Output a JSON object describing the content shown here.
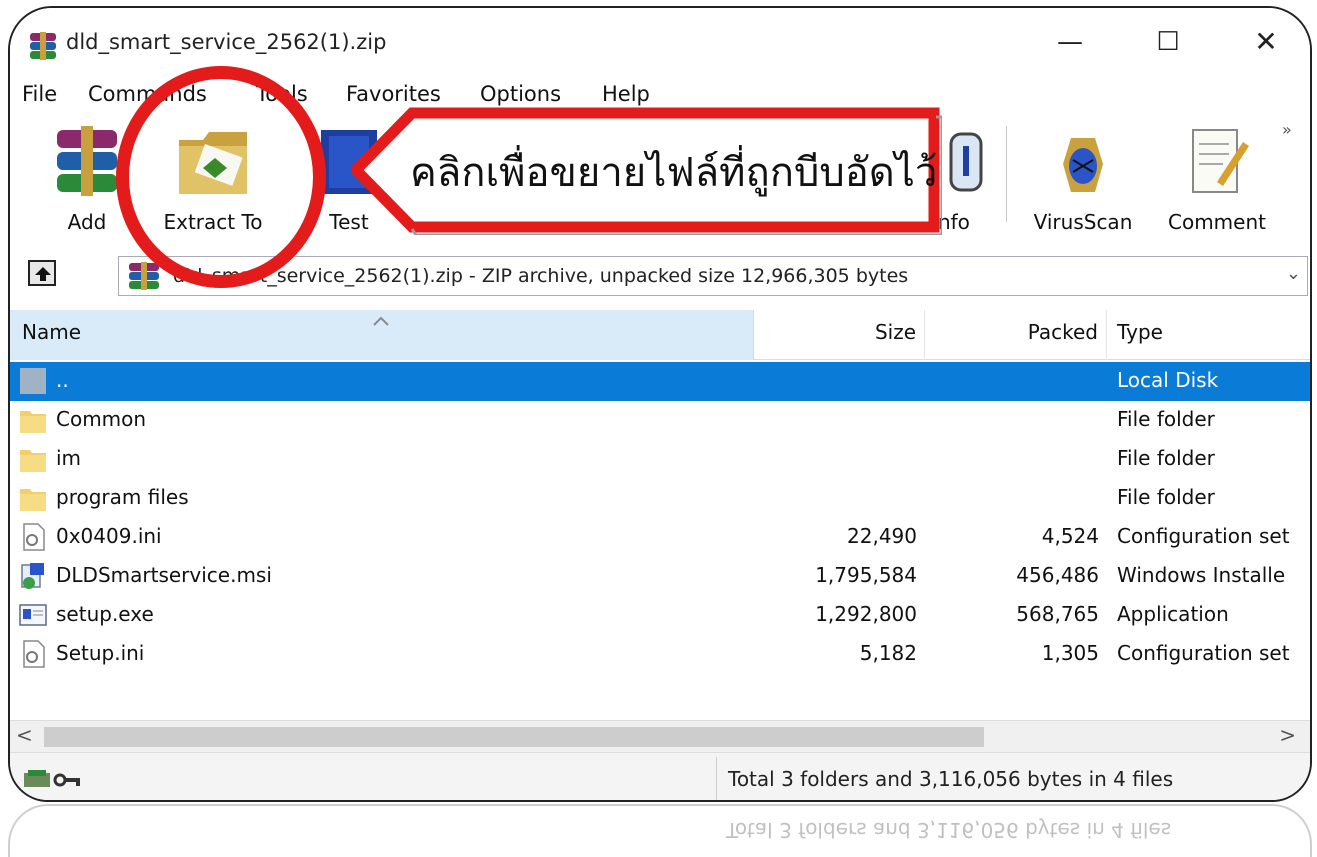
{
  "window": {
    "title": "dld_smart_service_2562(1).zip",
    "minimize": "—",
    "maximize": "☐",
    "close": "✕"
  },
  "menu": [
    "File",
    "Commands",
    "Tools",
    "Favorites",
    "Options",
    "Help"
  ],
  "toolbar": {
    "add_label": "Add",
    "extract_label": "Extract To",
    "test_label": "Test",
    "info_label": "Info",
    "virusscan_label": "VirusScan",
    "comment_label": "Comment",
    "more": "»"
  },
  "address": {
    "text": "dld_smart_service_2562(1).zip - ZIP archive, unpacked size 12,966,305 bytes",
    "dropdown": "⌄"
  },
  "columns": {
    "name": "Name",
    "size": "Size",
    "packed": "Packed",
    "type": "Type"
  },
  "files": [
    {
      "name": "..",
      "size": "",
      "packed": "",
      "type": "Local Disk",
      "icon": "parent-folder-icon",
      "selected": true
    },
    {
      "name": "Common",
      "size": "",
      "packed": "",
      "type": "File folder",
      "icon": "folder-icon"
    },
    {
      "name": "im",
      "size": "",
      "packed": "",
      "type": "File folder",
      "icon": "folder-icon"
    },
    {
      "name": "program files",
      "size": "",
      "packed": "",
      "type": "File folder",
      "icon": "folder-icon"
    },
    {
      "name": "0x0409.ini",
      "size": "22,490",
      "packed": "4,524",
      "type": "Configuration set",
      "icon": "ini-file-icon"
    },
    {
      "name": "DLDSmartservice.msi",
      "size": "1,795,584",
      "packed": "456,486",
      "type": "Windows Installe",
      "icon": "msi-file-icon"
    },
    {
      "name": "setup.exe",
      "size": "1,292,800",
      "packed": "568,765",
      "type": "Application",
      "icon": "exe-file-icon"
    },
    {
      "name": "Setup.ini",
      "size": "5,182",
      "packed": "1,305",
      "type": "Configuration set",
      "icon": "ini-file-icon"
    }
  ],
  "scroll": {
    "left": "<",
    "right": ">"
  },
  "status": {
    "text": "Total 3 folders and 3,116,056 bytes in 4 files"
  },
  "annotation": {
    "callout_text": "คลิกเพื่อขยายไฟล์ที่ถูกบีบอัดไว้",
    "color": "#e31b1b"
  },
  "colors": {
    "selection": "#0a7bd6",
    "column_header_active": "#d9ebf9"
  }
}
